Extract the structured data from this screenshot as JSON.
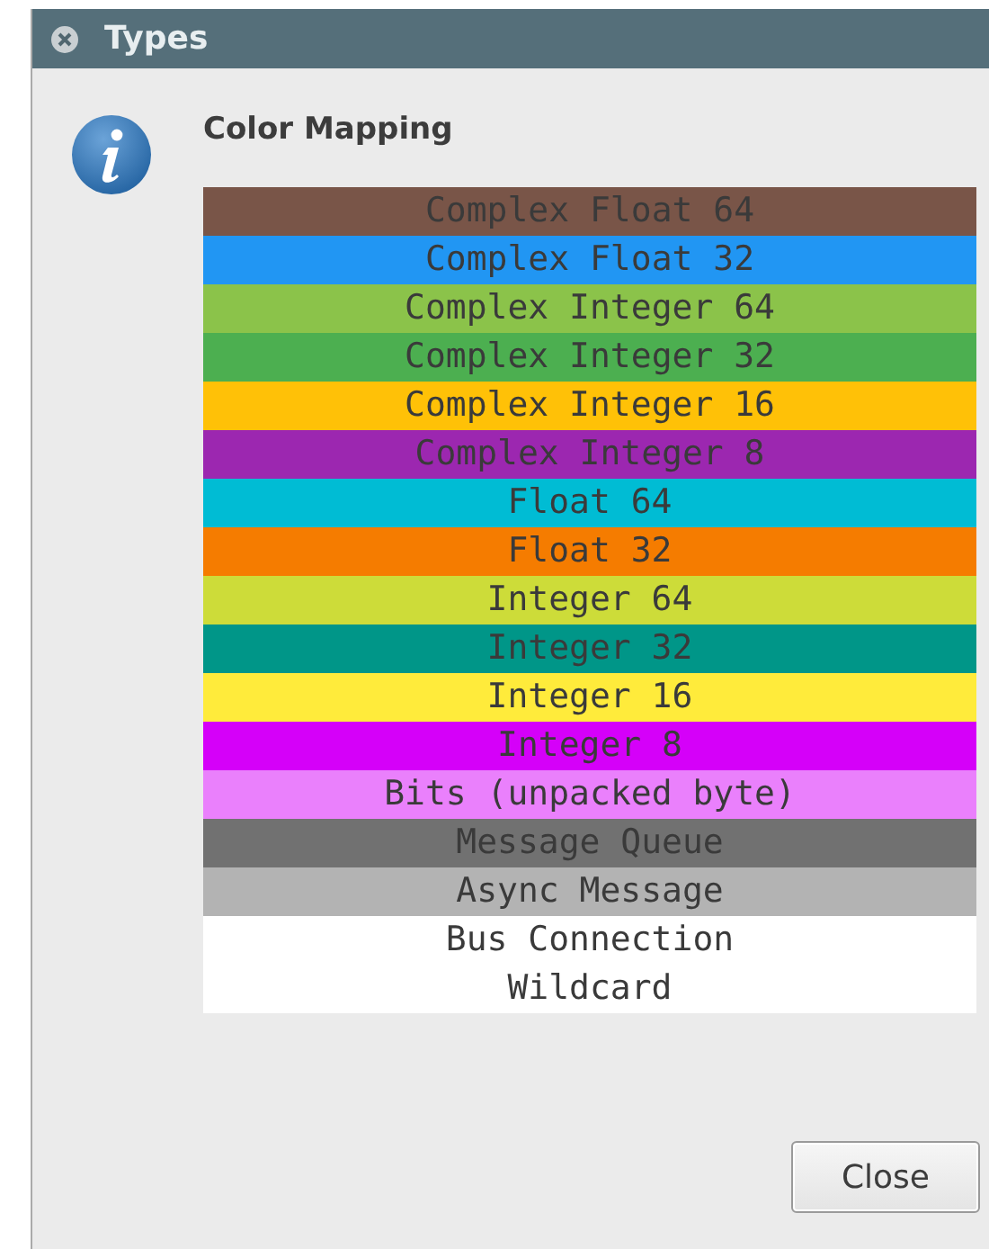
{
  "window": {
    "title": "Types"
  },
  "heading": "Color Mapping",
  "types": [
    {
      "label": "Complex Float 64",
      "color": "#795548"
    },
    {
      "label": "Complex Float 32",
      "color": "#2196f3"
    },
    {
      "label": "Complex Integer 64",
      "color": "#8bc34a"
    },
    {
      "label": "Complex Integer 32",
      "color": "#4caf50"
    },
    {
      "label": "Complex Integer 16",
      "color": "#ffc107"
    },
    {
      "label": "Complex Integer 8",
      "color": "#9c27b0"
    },
    {
      "label": "Float 64",
      "color": "#00bcd4"
    },
    {
      "label": "Float 32",
      "color": "#f57c00"
    },
    {
      "label": "Integer 64",
      "color": "#cddc39"
    },
    {
      "label": "Integer 32",
      "color": "#009688"
    },
    {
      "label": "Integer 16",
      "color": "#ffeb3b"
    },
    {
      "label": "Integer 8",
      "color": "#d500f9"
    },
    {
      "label": "Bits (unpacked byte)",
      "color": "#ea80fc"
    },
    {
      "label": "Message Queue",
      "color": "#717171"
    },
    {
      "label": "Async Message",
      "color": "#b3b3b3"
    },
    {
      "label": "Bus Connection",
      "color": "#ffffff"
    },
    {
      "label": "Wildcard",
      "color": "#ffffff"
    }
  ],
  "buttons": [
    "Close"
  ]
}
